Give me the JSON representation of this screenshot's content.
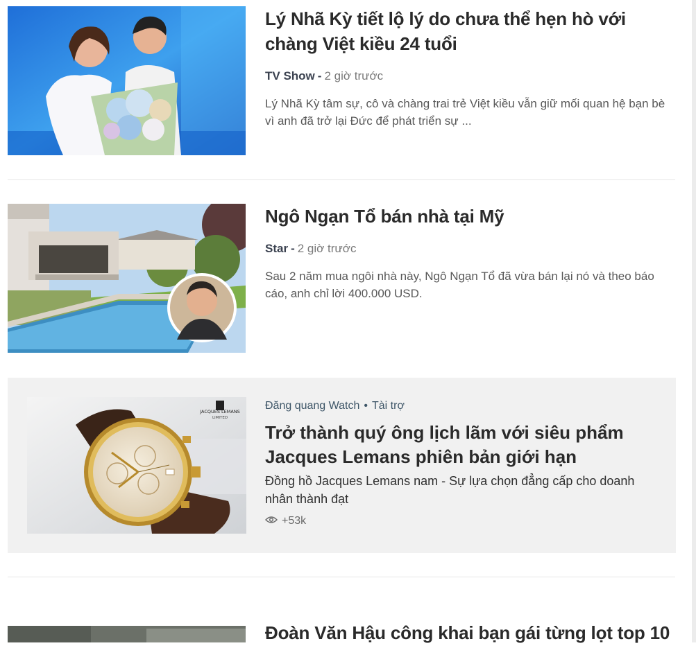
{
  "articles": [
    {
      "title": "Lý Nhã Kỳ tiết lộ lý do chưa thể hẹn hò với chàng Việt kiều 24 tuổi",
      "category": "TV Show",
      "time": "2 giờ trước",
      "description": "Lý Nhã Kỳ tâm sự, cô và chàng trai trẻ Việt kiều vẫn giữ mối quan hệ bạn bè vì anh đã trở lại Đức để phát triển sự ..."
    },
    {
      "title": "Ngô Ngạn Tổ bán nhà tại Mỹ",
      "category": "Star",
      "time": "2 giờ trước",
      "description": "Sau 2 năm mua ngôi nhà này, Ngô Ngạn Tổ đã vừa bán lại nó và theo báo cáo, anh chỉ lời 400.000 USD."
    },
    {
      "title": "Đoàn Văn Hậu công khai bạn gái từng lọt top 10"
    }
  ],
  "sponsored": {
    "brand": "Đăng quang Watch",
    "dot": "•",
    "tag": "Tài trợ",
    "title": "Trở thành quý ông lịch lãm với siêu phẩm Jacques Lemans phiên bản giới hạn",
    "description": "Đồng hồ Jacques Lemans nam - Sự lựa chọn đẳng cấp cho doanh nhân thành đạt",
    "views": "+53k",
    "logo_line1": "JACQUES LEMANS",
    "logo_line2": "LIMITED"
  },
  "meta_separator": "-",
  "icons": {
    "views": "eye-icon"
  }
}
